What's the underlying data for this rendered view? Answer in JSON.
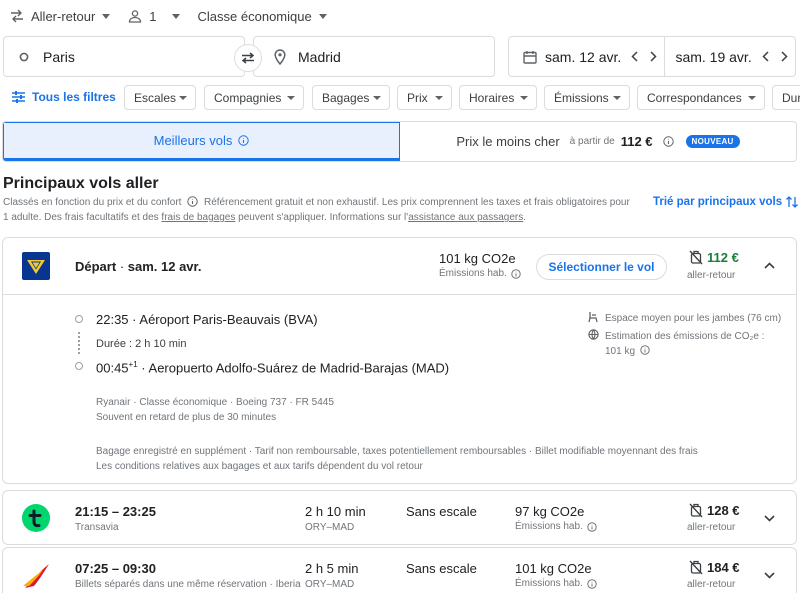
{
  "trip_options": {
    "trip_type": "Aller-retour",
    "passengers": "1",
    "cabin": "Classe économique"
  },
  "search": {
    "origin": "Paris",
    "destination": "Madrid",
    "depart_date": "sam. 12 avr.",
    "return_date": "sam. 19 avr."
  },
  "filters": {
    "all_filters": "Tous les filtres",
    "chips": [
      "Escales",
      "Compagnies",
      "Bagages",
      "Prix",
      "Horaires",
      "Émissions",
      "Correspondances",
      "Dur"
    ]
  },
  "sort_tabs": {
    "best": "Meilleurs vols",
    "cheapest": "Prix le moins cher",
    "from_label": "à partir de",
    "cheapest_price": "112 €",
    "new_badge": "NOUVEAU"
  },
  "section": {
    "title": "Principaux vols aller",
    "desc_1": "Classés en fonction du prix et du confort",
    "desc_2": "Référencement gratuit et non exhaustif. Les prix comprennent les taxes et frais obligatoires pour",
    "desc_3": "1 adulte. Des frais facultatifs et des",
    "desc_link_1": "frais de bagages",
    "desc_4": "peuvent s'appliquer. Informations sur l'",
    "desc_link_2": "assistance aux passagers",
    "desc_5": ".",
    "sort_label": "Trié par principaux vols"
  },
  "selected_flight": {
    "depart_label": "Départ",
    "depart_date": "sam. 12 avr.",
    "co2": "101 kg CO2e",
    "co2_sub": "Émissions hab.",
    "select_button": "Sélectionner le vol",
    "price": "112 €",
    "price_sub": "aller-retour",
    "dep_time": "22:35",
    "dep_airport": "Aéroport Paris-Beauvais (BVA)",
    "duration": "Durée : 2 h 10 min",
    "arr_time": "00:45",
    "arr_day_offset": "+1",
    "arr_airport": "Aeropuerto Adolfo-Suárez de Madrid-Barajas (MAD)",
    "flight_info": "Ryanair · Classe économique · Boeing 737 · FR 5445",
    "delay_info": "Souvent en retard de plus de 30 minutes",
    "baggage_info": "Bagage enregistré en supplément · Tarif non remboursable, taxes potentiellement remboursables · Billet modifiable moyennant des frais",
    "conditions_info": "Les conditions relatives aux bagages et aux tarifs dépendent du vol retour",
    "legroom": "Espace moyen pour les jambes (76 cm)",
    "emissions_estimate": "Estimation des émissions de CO₂e :",
    "emissions_value": "101 kg"
  },
  "flights": [
    {
      "times": "21:15 – 23:25",
      "airline": "Transavia",
      "duration": "2 h 10 min",
      "route": "ORY–MAD",
      "stops": "Sans escale",
      "co2": "97 kg CO2e",
      "co2_sub": "Émissions hab.",
      "price": "128 €",
      "price_sub": "aller-retour"
    },
    {
      "times": "07:25 – 09:30",
      "airline": "Billets séparés dans une même réservation · Iberia",
      "duration": "2 h 5 min",
      "route": "ORY–MAD",
      "stops": "Sans escale",
      "co2": "101 kg CO2e",
      "co2_sub": "Émissions hab.",
      "price": "184 €",
      "price_sub": "aller-retour"
    }
  ],
  "colors": {
    "accent": "#1a73e8",
    "price_green": "#188038",
    "text": "#202124",
    "muted": "#70757a"
  }
}
